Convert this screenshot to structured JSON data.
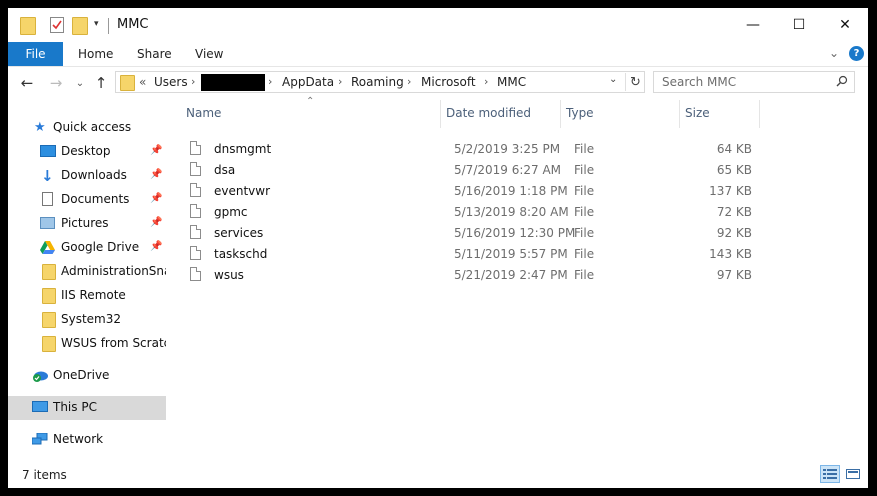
{
  "window": {
    "title": "MMC"
  },
  "window_controls": {
    "minimize": "—",
    "maximize": "☐",
    "close": "✕"
  },
  "ribbon": {
    "file": "File",
    "tabs": [
      "Home",
      "Share",
      "View"
    ],
    "expand_glyph": "⌄",
    "help_glyph": "?"
  },
  "nav": {
    "back": "←",
    "forward": "→",
    "recent": "⌄",
    "up": "↑"
  },
  "address": {
    "prefix": "«",
    "segments": [
      "Users",
      "AppData",
      "Roaming",
      "Microsoft",
      "MMC"
    ],
    "separator": "›",
    "dropdown_glyph": "⌄",
    "refresh_glyph": "↻"
  },
  "search": {
    "placeholder": "Search MMC"
  },
  "sidebar": {
    "quick_access": "Quick access",
    "pinned": [
      {
        "label": "Desktop",
        "icon": "desktop-icon"
      },
      {
        "label": "Downloads",
        "icon": "downloads-icon"
      },
      {
        "label": "Documents",
        "icon": "documents-icon"
      },
      {
        "label": "Pictures",
        "icon": "pictures-icon"
      },
      {
        "label": "Google Drive",
        "icon": "google-drive-icon"
      }
    ],
    "folders": [
      "AdministrationSnapins",
      "IIS Remote",
      "System32",
      "WSUS from Scratch"
    ],
    "onedrive": "OneDrive",
    "this_pc": "This PC",
    "network": "Network"
  },
  "columns": {
    "name": "Name",
    "date": "Date modified",
    "type": "Type",
    "size": "Size",
    "sort_glyph": "⌃"
  },
  "files": [
    {
      "name": "dnsmgmt",
      "date": "5/2/2019 3:25 PM",
      "type": "File",
      "size": "64 KB"
    },
    {
      "name": "dsa",
      "date": "5/7/2019 6:27 AM",
      "type": "File",
      "size": "65 KB"
    },
    {
      "name": "eventvwr",
      "date": "5/16/2019 1:18 PM",
      "type": "File",
      "size": "137 KB"
    },
    {
      "name": "gpmc",
      "date": "5/13/2019 8:20 AM",
      "type": "File",
      "size": "72 KB"
    },
    {
      "name": "services",
      "date": "5/16/2019 12:30 PM",
      "type": "File",
      "size": "92 KB"
    },
    {
      "name": "taskschd",
      "date": "5/11/2019 5:57 PM",
      "type": "File",
      "size": "143 KB"
    },
    {
      "name": "wsus",
      "date": "5/21/2019 2:47 PM",
      "type": "File",
      "size": "97 KB"
    }
  ],
  "status": {
    "items": "7 items"
  },
  "colors": {
    "accent": "#1979ca",
    "folder": "#f6d56a",
    "selected": "#d9d9d9",
    "header_text": "#4c607a"
  }
}
